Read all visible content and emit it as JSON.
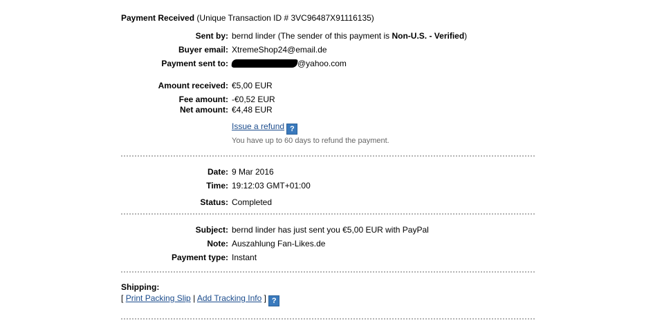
{
  "header": {
    "title": "Payment Received",
    "transaction": "(Unique Transaction ID # 3VC96487X91116135)"
  },
  "details": {
    "sent_by": {
      "label": "Sent by:",
      "name": "bernd linder",
      "pre": "(The sender of this payment is",
      "status": "Non-U.S. - Verified",
      "post": ")"
    },
    "buyer_email": {
      "label": "Buyer email:",
      "value": "XtremeShop24@email.de"
    },
    "payment_sent_to": {
      "label": "Payment sent to:",
      "domain": "@yahoo.com"
    }
  },
  "amounts": {
    "received": {
      "label": "Amount received:",
      "value": "€5,00 EUR"
    },
    "fee": {
      "label": "Fee amount:",
      "value": "-€0,52 EUR"
    },
    "net": {
      "label": "Net amount:",
      "value": "€4,48 EUR"
    },
    "refund_link": "Issue a refund",
    "refund_note": "You have up to 60 days to refund the payment."
  },
  "status_block": {
    "date": {
      "label": "Date:",
      "value": "9 Mar 2016"
    },
    "time": {
      "label": "Time:",
      "value": "19:12:03 GMT+01:00"
    },
    "status": {
      "label": "Status:",
      "value": "Completed"
    }
  },
  "message": {
    "subject": {
      "label": "Subject:",
      "value": "bernd linder has just sent you €5,00 EUR with PayPal"
    },
    "note": {
      "label": "Note:",
      "value": "Auszahlung Fan-Likes.de"
    },
    "payment_type": {
      "label": "Payment type:",
      "value": "Instant"
    }
  },
  "shipping": {
    "title": "Shipping:",
    "open_bracket": "[",
    "print_slip": "Print Packing Slip",
    "separator": "|",
    "add_tracking": "Add Tracking Info",
    "close_bracket": "]"
  },
  "help_icon_glyph": "?",
  "colors": {
    "link": "#1a4b8c",
    "help_icon": "#3a7abd",
    "note_text": "#666666",
    "divider": "#b3b3b3"
  }
}
